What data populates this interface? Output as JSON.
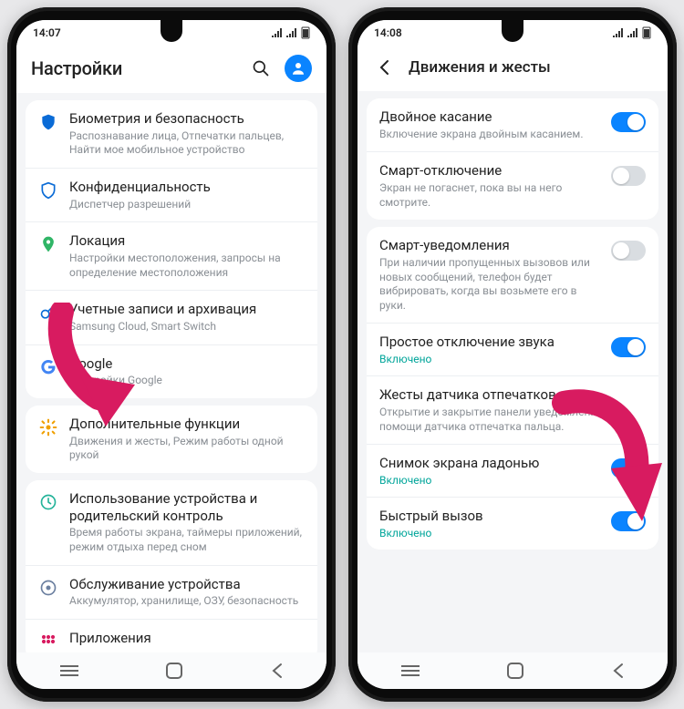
{
  "left": {
    "status_time": "14:07",
    "header_title": "Настройки",
    "groups": [
      [
        {
          "icon": "shield",
          "icon_color": "#0a6bd6",
          "title": "Биометрия и безопасность",
          "sub": "Распознавание лица, Отпечатки пальцев, Найти мое мобильное устройство"
        },
        {
          "icon": "shield-outline",
          "icon_color": "#0a6bd6",
          "title": "Конфиденциальность",
          "sub": "Диспетчер разрешений"
        },
        {
          "icon": "pin",
          "icon_color": "#30b566",
          "title": "Локация",
          "sub": "Настройки местоположения, запросы на определение местоположения"
        },
        {
          "icon": "key",
          "icon_color": "#0a6bd6",
          "title": "Учетные записи и архивация",
          "sub": "Samsung Cloud, Smart Switch"
        },
        {
          "icon": "google",
          "icon_color": "#4285f4",
          "title": "Google",
          "sub": "Настройки Google"
        }
      ],
      [
        {
          "icon": "gear",
          "icon_color": "#f0a000",
          "title": "Дополнительные функции",
          "sub": "Движения и жесты, Режим работы одной рукой"
        }
      ],
      [
        {
          "icon": "wellbeing",
          "icon_color": "#24b39a",
          "title": "Использование устройства и родительский контроль",
          "sub": "Время работы экрана, таймеры приложений, режим отдыха перед сном"
        },
        {
          "icon": "care",
          "icon_color": "#6c80a0",
          "title": "Обслуживание устройства",
          "sub": "Аккумулятор, хранилище, ОЗУ, безопасность"
        },
        {
          "icon": "apps",
          "icon_color": "#d81b60",
          "title": "Приложения",
          "sub": ""
        }
      ]
    ]
  },
  "right": {
    "status_time": "14:08",
    "header_title": "Движения и жесты",
    "groups": [
      [
        {
          "title": "Двойное касание",
          "sub": "Включение экрана двойным касанием.",
          "toggle": true
        },
        {
          "title": "Смарт-отключение",
          "sub": "Экран не погаснет, пока вы на него смотрите.",
          "toggle": false
        }
      ],
      [
        {
          "title": "Смарт-уведомления",
          "sub": "При наличии пропущенных вызовов или новых сообщений, телефон будет вибрировать, когда вы возьмете его в руки.",
          "toggle": false
        },
        {
          "title": "Простое отключение звука",
          "status": "Включено",
          "toggle": true
        },
        {
          "title": "Жесты датчика отпечатков",
          "sub": "Открытие и закрытие панели уведомлений при помощи датчика отпечатка пальца."
        },
        {
          "title": "Снимок экрана ладонью",
          "status": "Включено",
          "toggle": true
        },
        {
          "title": "Быстрый вызов",
          "status": "Включено",
          "toggle": true
        }
      ]
    ]
  }
}
